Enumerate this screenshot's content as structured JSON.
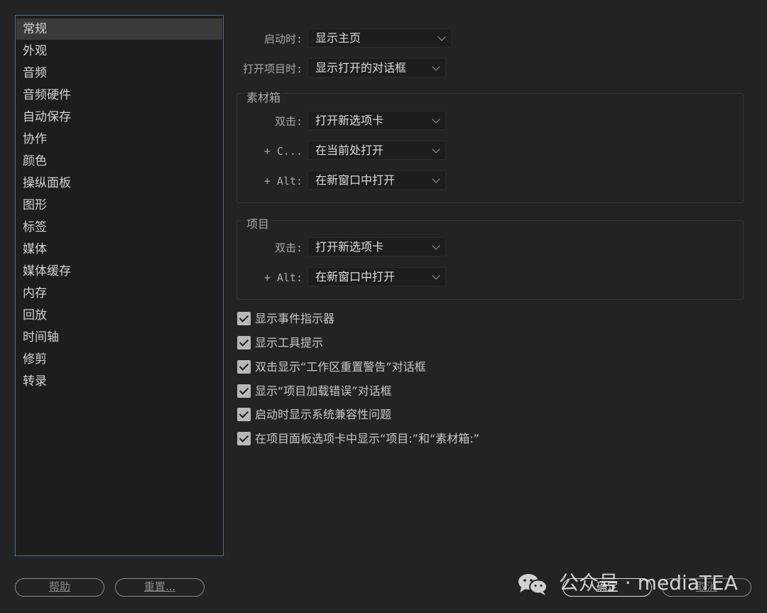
{
  "sidebar": {
    "items": [
      "常规",
      "外观",
      "音频",
      "音频硬件",
      "自动保存",
      "协作",
      "颜色",
      "操纵面板",
      "图形",
      "标签",
      "媒体",
      "媒体缓存",
      "内存",
      "回放",
      "时间轴",
      "修剪",
      "转录"
    ],
    "selected": "常规"
  },
  "startup": {
    "label": "启动时:",
    "value": "显示主页"
  },
  "open_project": {
    "label": "打开项目时:",
    "value": "显示打开的对话框"
  },
  "bin_group": {
    "title": "素材箱",
    "double_click": {
      "label": "双击:",
      "value": "打开新选项卡"
    },
    "ctrl_click": {
      "label": "+ C...",
      "value": "在当前处打开"
    },
    "alt_click": {
      "label": "+ Alt:",
      "value": "在新窗口中打开"
    }
  },
  "project_group": {
    "title": "项目",
    "double_click": {
      "label": "双击:",
      "value": "打开新选项卡"
    },
    "alt_click": {
      "label": "+ Alt:",
      "value": "在新窗口中打开"
    }
  },
  "checkboxes": [
    {
      "label": "显示事件指示器",
      "checked": true
    },
    {
      "label": "显示工具提示",
      "checked": true
    },
    {
      "label": "双击显示“工作区重置警告”对话框",
      "checked": true
    },
    {
      "label": "显示“项目加载错误”对话框",
      "checked": true
    },
    {
      "label": "启动时显示系统兼容性问题",
      "checked": true
    },
    {
      "label": "在项目面板选项卡中显示“项目:”和“素材箱:”",
      "checked": true
    }
  ],
  "buttons": {
    "help": "帮助",
    "reset": "重置...",
    "ok": "确定",
    "cancel": "取消"
  },
  "watermark": {
    "text": "公众号 · mediaTEA",
    "icon": "wechat-icon"
  },
  "colors": {
    "sidebar_border": "#3f6fb0",
    "background": "#232323",
    "selected_row": "#3a3a3a"
  }
}
